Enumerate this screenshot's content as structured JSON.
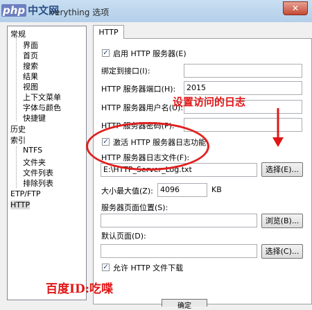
{
  "window": {
    "title_visible": "verything 选项",
    "watermark_brand": "php",
    "watermark_text": "中文网",
    "close_glyph": "✕"
  },
  "tree": {
    "items": [
      "常规",
      "界面",
      "首页",
      "搜索",
      "结果",
      "视图",
      "上下文菜单",
      "字体与颜色",
      "快捷键",
      "历史",
      "索引",
      "NTFS",
      "文件夹",
      "文件列表",
      "排除列表",
      "ETP/FTP",
      "HTTP"
    ],
    "selected": "HTTP"
  },
  "tab": {
    "label": "HTTP"
  },
  "form": {
    "enable_server_label": "启用 HTTP 服务器(E)",
    "enable_server_checked": true,
    "bind_interface_label": "绑定到接口(I):",
    "bind_interface_value": "",
    "port_label": "HTTP 服务器端口(H):",
    "port_value": "2015",
    "username_label": "HTTP 服务器用户名(U):",
    "username_value": "",
    "password_label": "HTTP 服务器密码(P):",
    "password_value": "",
    "enable_log_label": "激活 HTTP 服务器日志功能",
    "enable_log_checked": true,
    "log_file_label": "HTTP 服务器日志文件(F):",
    "log_file_value": "E:\\HTTP_Server_Log.txt",
    "log_file_button": "选择(E)...",
    "max_size_label": "大小最大值(Z):",
    "max_size_value": "4096",
    "max_size_unit": "KB",
    "page_location_label": "服务器页面位置(S):",
    "page_location_value": "",
    "browse_button": "浏览(B)...",
    "default_page_label": "默认页面(D):",
    "default_page_value": "",
    "default_page_button": "选择(C)...",
    "allow_download_label": "允许 HTTP 文件下载",
    "allow_download_checked": true
  },
  "annotations": {
    "callout": "设置访问的日志",
    "author": "百度ID:吃喋",
    "colors": {
      "annotation_red": "#e01616"
    }
  },
  "footer": {
    "button_partial": "确定"
  }
}
